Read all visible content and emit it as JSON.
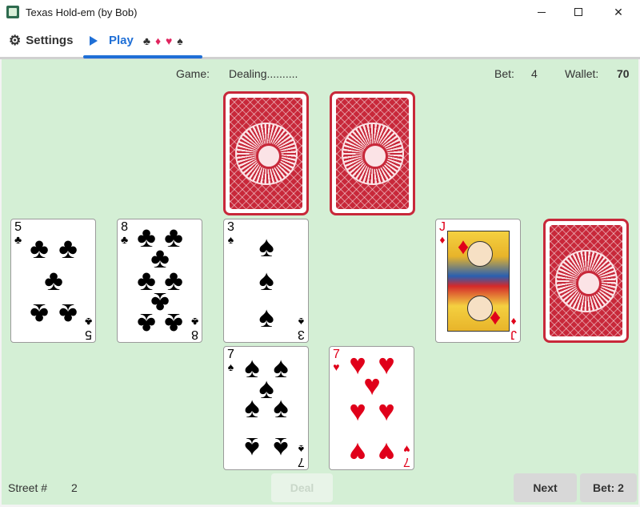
{
  "window": {
    "title": "Texas Hold-em (by Bob)",
    "controls": {
      "minimize": "—",
      "maximize": "☐",
      "close": "✕"
    }
  },
  "tabs": {
    "settings": {
      "label": "Settings",
      "icon": "gear-icon"
    },
    "play": {
      "label": "Play",
      "icon": "play-icon",
      "suits": [
        "♣",
        "♦",
        "♥",
        "♠"
      ]
    }
  },
  "status": {
    "game_label": "Game:",
    "game_value": "Dealing..........",
    "bet_label": "Bet:",
    "bet_value": "4",
    "wallet_label": "Wallet:",
    "wallet_value": "70",
    "street_label": "Street #",
    "street_value": "2"
  },
  "cards": {
    "left_1": {
      "rank": "5",
      "suit": "♣",
      "color": "#000000"
    },
    "left_2": {
      "rank": "8",
      "suit": "♣",
      "color": "#000000"
    },
    "center_top": {
      "rank": "3",
      "suit": "♠",
      "color": "#000000"
    },
    "center_bottom": {
      "rank": "7",
      "suit": "♠",
      "color": "#000000"
    },
    "hearts": {
      "rank": "7",
      "suit": "♥",
      "color": "#e0001a"
    },
    "jack": {
      "rank": "J",
      "suit": "♦",
      "color": "#e0001a"
    }
  },
  "buttons": {
    "deal": "Deal",
    "next": "Next",
    "bet": "Bet: 2"
  },
  "colors": {
    "table": "#d4efd5",
    "accent": "#1f6fd6",
    "card_back": "#c8283a"
  }
}
